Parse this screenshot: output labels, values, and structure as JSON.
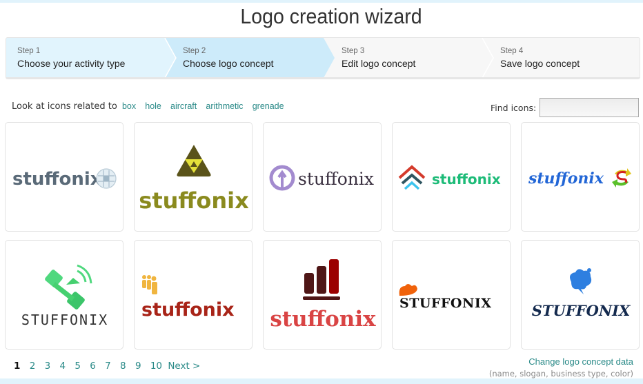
{
  "page_title": "Logo creation wizard",
  "steps": [
    {
      "number": "Step 1",
      "label": "Choose your activity type",
      "state": "done",
      "color": "#e1f4fd"
    },
    {
      "number": "Step 2",
      "label": "Choose logo concept",
      "state": "active",
      "color": "#cdebfa"
    },
    {
      "number": "Step 3",
      "label": "Edit logo concept",
      "state": "pending",
      "color": "#f7f7f7"
    },
    {
      "number": "Step 4",
      "label": "Save logo concept",
      "state": "pending",
      "color": "#f7f7f7"
    }
  ],
  "related": {
    "prefix": "Look at icons related to",
    "tags": [
      "box",
      "hole",
      "aircraft",
      "arithmetic",
      "grenade"
    ]
  },
  "find_icons": {
    "label": "Find icons:",
    "value": "",
    "placeholder": ""
  },
  "logos": [
    {
      "name": "stuffonix",
      "icon": "globe-maze-icon",
      "text_color": "#5a6a78"
    },
    {
      "name": "stuffonix",
      "icon": "triangle-hazard-icon",
      "text_color": "#8a8a1e"
    },
    {
      "name": "stuffonix",
      "icon": "circle-up-arrow-icon",
      "text_color": "#3a3040"
    },
    {
      "name": "stuffonix",
      "icon": "chevron-stack-icon",
      "text_color": "#1dbb78"
    },
    {
      "name": "stuffonix",
      "icon": "sync-arrows-s-icon",
      "text_color": "#2266d6"
    },
    {
      "name": "STUFFONIX",
      "icon": "satellite-icon",
      "text_color": "#333333"
    },
    {
      "name": "stuffonix",
      "icon": "people-group-icon",
      "text_color": "#a82418"
    },
    {
      "name": "stuffonix",
      "icon": "bar-chart-icon",
      "text_color": "#d94444"
    },
    {
      "name": "STUFFONIX",
      "icon": "orange-cloud-icon",
      "text_color": "#111111"
    },
    {
      "name": "STUFFONIX",
      "icon": "speech-cloud-icon",
      "text_color": "#142a4e"
    }
  ],
  "pagination": {
    "pages": [
      "1",
      "2",
      "3",
      "4",
      "5",
      "6",
      "7",
      "8",
      "9",
      "10"
    ],
    "current": "1",
    "next_label": "Next >"
  },
  "footer": {
    "change_link": "Change logo concept data",
    "change_sub": "(name, slogan, business type, color)"
  },
  "colors": {
    "link": "#2a8a88",
    "strip": "#e1f3fc"
  }
}
